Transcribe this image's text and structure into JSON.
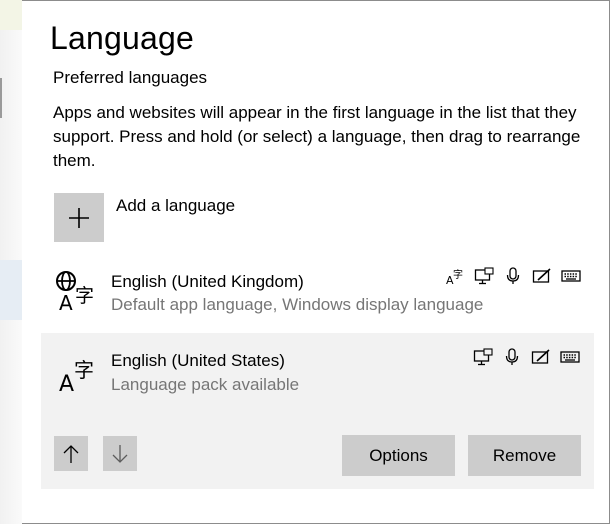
{
  "page": {
    "title": "Language",
    "section_title": "Preferred languages",
    "description": "Apps and websites will appear in the first language in the list that they support. Press and hold (or select) a language, then drag to rearrange them."
  },
  "add_language": {
    "label": "Add a language",
    "icon": "plus-icon"
  },
  "languages": [
    {
      "name": "English (United Kingdom)",
      "status": "Default app language, Windows display language",
      "icon": "language-globe-icon",
      "features": [
        "text-to-speech-icon",
        "display-language-icon",
        "speech-recognition-icon",
        "handwriting-icon",
        "keyboard-icon"
      ],
      "selected": false
    },
    {
      "name": "English (United States)",
      "status": "Language pack available",
      "icon": "language-icon",
      "features": [
        "display-language-icon",
        "speech-recognition-icon",
        "handwriting-icon",
        "keyboard-icon"
      ],
      "selected": true
    }
  ],
  "selected_actions": {
    "move_up_icon": "arrow-up-icon",
    "move_down_icon": "arrow-down-icon",
    "options_label": "Options",
    "remove_label": "Remove"
  },
  "colors": {
    "button_bg": "#cccccc",
    "selected_row_bg": "#f2f2f2",
    "secondary_text": "#767676"
  }
}
